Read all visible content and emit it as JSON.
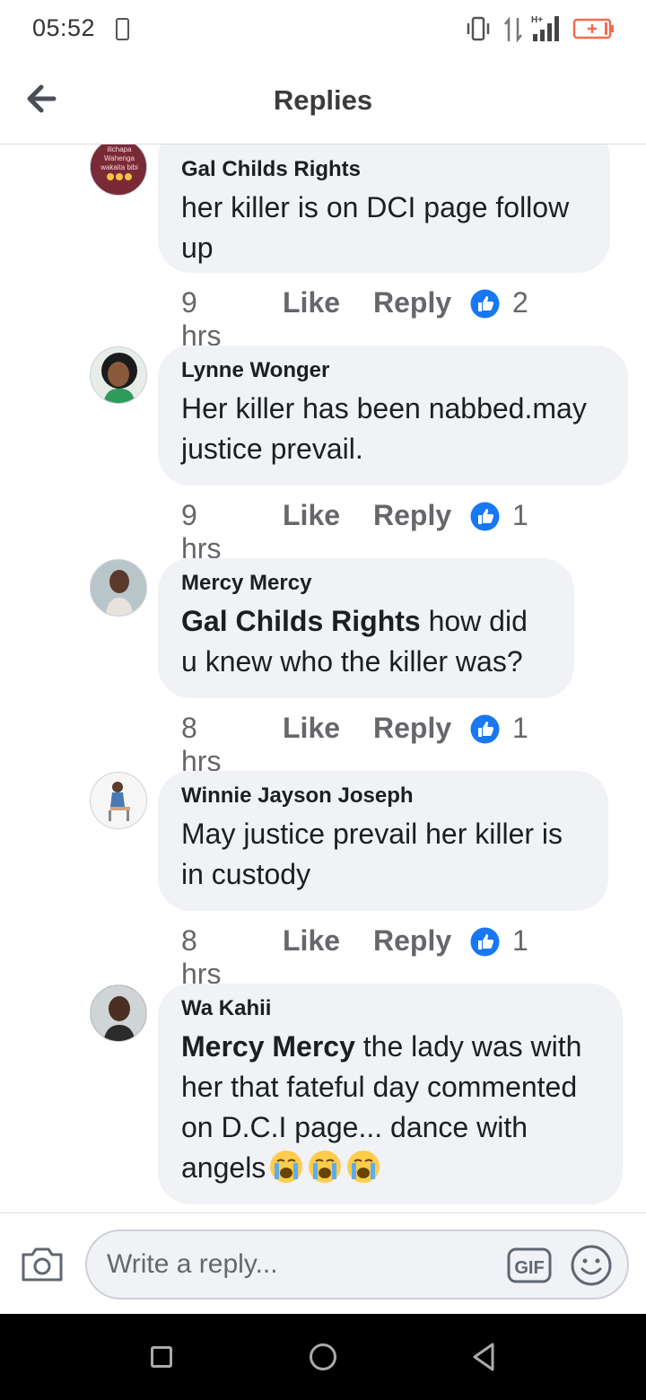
{
  "status_bar": {
    "time": "05:52",
    "data_label": "H+",
    "battery_color": "#f26b50"
  },
  "header": {
    "back_icon": "arrow-left-icon",
    "title": "Replies"
  },
  "comments": [
    {
      "author": "Gal Childs Rights",
      "avatar_text": [
        "ilichapa",
        "Wahenga",
        "wakaita bibi"
      ],
      "mention": "",
      "text": "her killer is on DCI page follow up",
      "time": "9 hrs",
      "like_label": "Like",
      "reply_label": "Reply",
      "reactions": "2"
    },
    {
      "author": "Lynne Wonger",
      "mention": "",
      "text": "Her killer has been nabbed.may justice prevail.",
      "time": "9 hrs",
      "like_label": "Like",
      "reply_label": "Reply",
      "reactions": "1"
    },
    {
      "author": "Mercy Mercy",
      "mention": "Gal Childs Rights",
      "text": " how did u knew who the killer was?",
      "time": "8 hrs",
      "like_label": "Like",
      "reply_label": "Reply",
      "reactions": "1"
    },
    {
      "author": "Winnie Jayson Joseph",
      "mention": "",
      "text": "May justice prevail her killer is in custody",
      "time": "8 hrs",
      "like_label": "Like",
      "reply_label": "Reply",
      "reactions": "1"
    },
    {
      "author": "Wa Kahii",
      "mention": "Mercy Mercy",
      "text": " the lady was with her that fateful day commented on D.C.I page... dance with angels",
      "emoji": "loudly-crying-face-icon",
      "emoji_count": 3
    }
  ],
  "reply_bar": {
    "placeholder": "Write a reply...",
    "gif_label": "GIF",
    "camera_icon": "camera-icon",
    "emoji_icon": "smiley-icon"
  },
  "colors": {
    "like_blue": "#1877f2",
    "bubble_bg": "#f0f2f5",
    "meta_gray": "#65676b"
  }
}
